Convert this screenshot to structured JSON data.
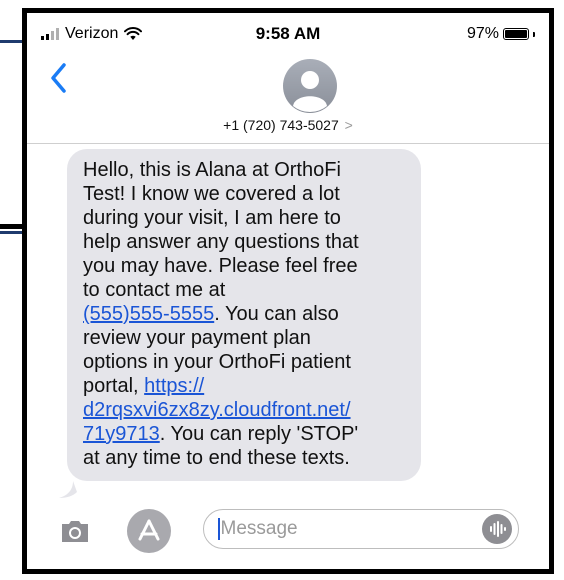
{
  "status_bar": {
    "carrier": "Verizon",
    "time": "9:58 AM",
    "battery_percent": "97%"
  },
  "contact": {
    "number": "+1 (720) 743-5027",
    "chevron": ">"
  },
  "message": {
    "lines": [
      {
        "text": "Hello, this is Alana at OrthoFi"
      },
      {
        "text": "Test! I know we covered a lot"
      },
      {
        "text": "during your visit, I am here to"
      },
      {
        "text": "help answer any questions that"
      },
      {
        "text": "you may have. Please feel free"
      },
      {
        "text": "to contact me at"
      }
    ],
    "phone_link": "(555)555-5555",
    "after_phone": ". You can also",
    "line_review": "review your payment plan",
    "line_options": "options in your OrthoFi patient",
    "line_portal_prefix": "portal, ",
    "url_part1": "https://",
    "url_part2": "d2rqsxvi6zx8zy.cloudfront.net/",
    "url_part3": "71y9713",
    "after_url": ". You can reply 'STOP'",
    "last_line": "at any time to end these texts."
  },
  "input": {
    "placeholder": "Message"
  },
  "icons": {
    "back": "chevron-left-icon",
    "avatar": "person-icon",
    "camera": "camera-icon",
    "appstore": "app-store-icon",
    "audio": "audio-waveform-icon",
    "wifi": "wifi-icon",
    "signal": "signal-bars-icon",
    "battery": "battery-icon"
  },
  "colors": {
    "link": "#1a55d6",
    "bubble": "#e5e5ea",
    "ios_blue": "#1a7cf5"
  }
}
